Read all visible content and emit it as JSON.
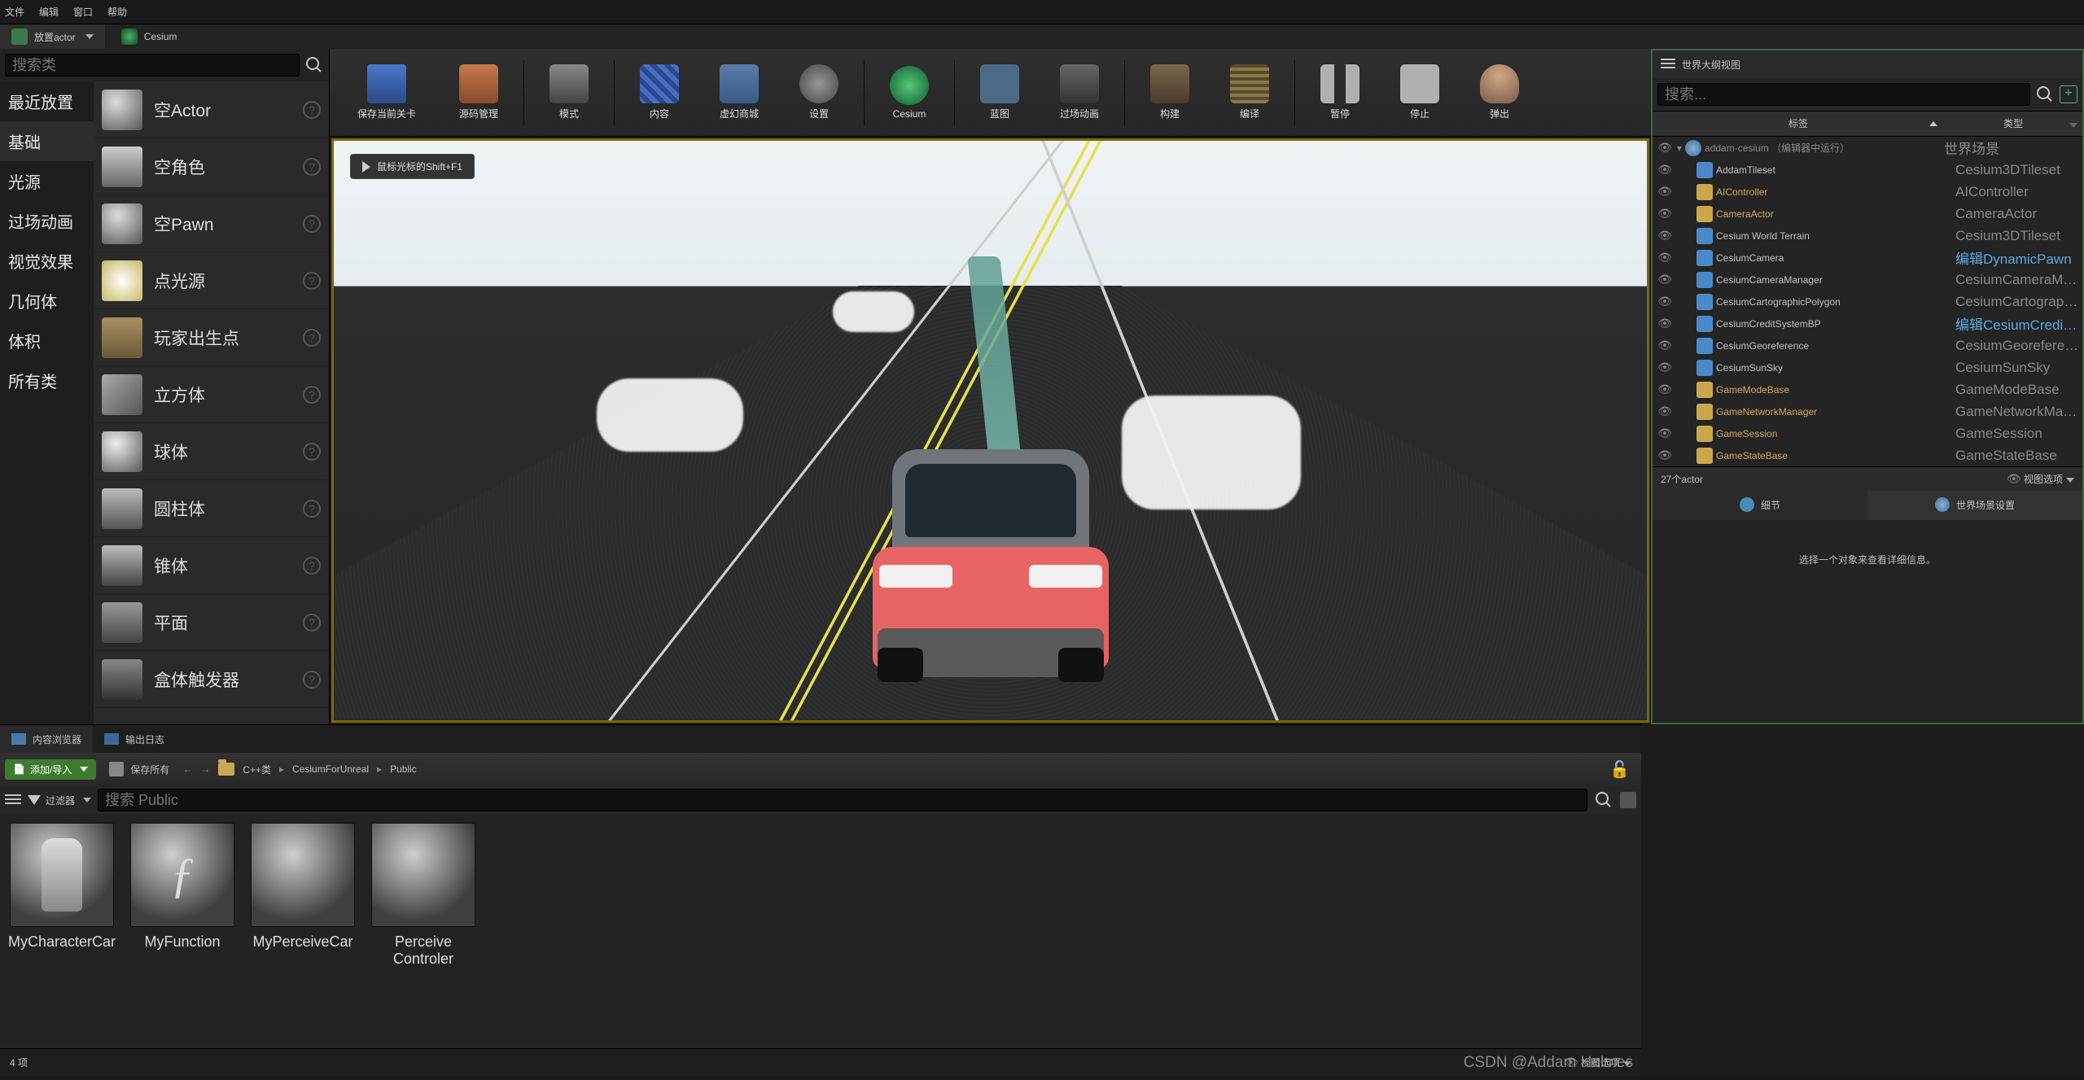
{
  "menu": {
    "file": "文件",
    "edit": "编辑",
    "window": "窗口",
    "help": "帮助"
  },
  "tabs": {
    "place_actor": "放置actor",
    "cesium": "Cesium"
  },
  "left": {
    "search_placeholder": "搜索类",
    "categories": [
      "最近放置",
      "基础",
      "光源",
      "过场动画",
      "视觉效果",
      "几何体",
      "体积",
      "所有类"
    ],
    "selected_category": "基础",
    "items": [
      {
        "name": "空Actor"
      },
      {
        "name": "空角色"
      },
      {
        "name": "空Pawn"
      },
      {
        "name": "点光源"
      },
      {
        "name": "玩家出生点"
      },
      {
        "name": "立方体"
      },
      {
        "name": "球体"
      },
      {
        "name": "圆柱体"
      },
      {
        "name": "锥体"
      },
      {
        "name": "平面"
      },
      {
        "name": "盒体触发器"
      }
    ]
  },
  "toolbar": {
    "save": "保存当前关卡",
    "source": "源码管理",
    "modes": "模式",
    "content": "内容",
    "market": "虚幻商城",
    "settings": "设置",
    "cesium": "Cesium",
    "blueprint": "蓝图",
    "cinematics": "过场动画",
    "build": "构建",
    "compile": "编译",
    "pause": "暂停",
    "stop": "停止",
    "eject": "弹出"
  },
  "viewport": {
    "hint": "鼠标光标的Shift+F1"
  },
  "outliner": {
    "title": "世界大纲视图",
    "search_placeholder": "搜索...",
    "col_label": "标签",
    "col_type": "类型",
    "root": {
      "name": "addam-cesium （编辑器中运行）",
      "type": "世界场景"
    },
    "rows": [
      {
        "name": "AddamTileset",
        "type": "Cesium3DTileset",
        "gold": false
      },
      {
        "name": "AIController",
        "type": "AIController",
        "gold": true
      },
      {
        "name": "CameraActor",
        "type": "CameraActor",
        "gold": true
      },
      {
        "name": "Cesium World Terrain",
        "type": "Cesium3DTileset",
        "gold": false
      },
      {
        "name": "CesiumCamera",
        "type": "编辑DynamicPawn",
        "gold": false,
        "typeblue": true
      },
      {
        "name": "CesiumCameraManager",
        "type": "CesiumCameraManager",
        "gold": false
      },
      {
        "name": "CesiumCartographicPolygon",
        "type": "CesiumCartographicPolygon",
        "gold": false
      },
      {
        "name": "CesiumCreditSystemBP",
        "type": "编辑CesiumCreditSystemBP",
        "gold": false,
        "typeblue": true
      },
      {
        "name": "CesiumGeoreference",
        "type": "CesiumGeoreference",
        "gold": false
      },
      {
        "name": "CesiumSunSky",
        "type": "CesiumSunSky",
        "gold": false
      },
      {
        "name": "GameModeBase",
        "type": "GameModeBase",
        "gold": true
      },
      {
        "name": "GameNetworkManager",
        "type": "GameNetworkManager",
        "gold": true
      },
      {
        "name": "GameSession",
        "type": "GameSession",
        "gold": true
      },
      {
        "name": "GameStateBase",
        "type": "GameStateBase",
        "gold": true
      }
    ],
    "count": "27个actor",
    "view_options": "视图选项"
  },
  "details": {
    "tab_details": "细节",
    "tab_world": "世界场景设置",
    "placeholder": "选择一个对象来查看详细信息。"
  },
  "cb": {
    "tab_content": "内容浏览器",
    "tab_log": "输出日志",
    "add_import": "添加/导入",
    "save_all": "保存所有",
    "crumb1": "C++类",
    "crumb2": "CesiumForUnreal",
    "crumb3": "Public",
    "filter": "过滤器",
    "search_placeholder": "搜索 Public",
    "items": [
      {
        "name": "MyCharacterCar"
      },
      {
        "name": "MyFunction"
      },
      {
        "name": "MyPerceiveCar"
      },
      {
        "name": "Perceive Controler"
      }
    ],
    "count": "4 项",
    "view_options": "视图选项"
  },
  "watermark": "CSDN @Addam Holmes"
}
